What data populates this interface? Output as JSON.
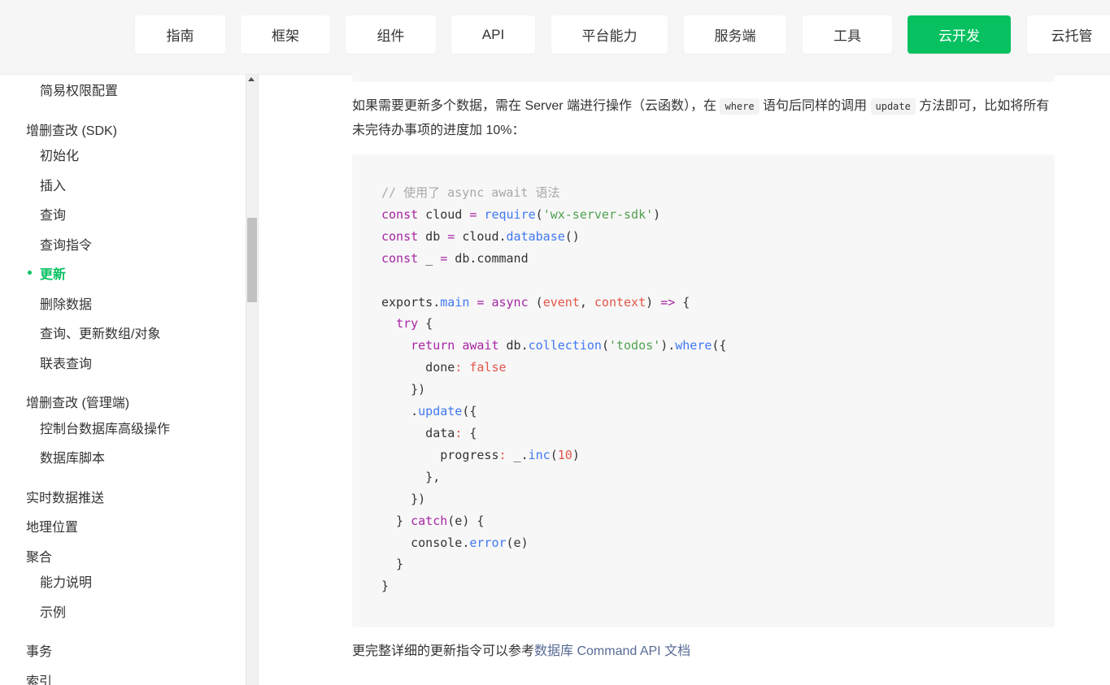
{
  "nav": {
    "items": [
      {
        "label": "指南"
      },
      {
        "label": "框架"
      },
      {
        "label": "组件"
      },
      {
        "label": "API"
      },
      {
        "label": "平台能力"
      },
      {
        "label": "服务端"
      },
      {
        "label": "工具"
      },
      {
        "label": "云开发",
        "active": true
      },
      {
        "label": "云托管"
      }
    ]
  },
  "sidebar": {
    "items": [
      {
        "label": "简易权限配置",
        "level": "sub"
      },
      {
        "label": "增删查改 (SDK)",
        "level": "group"
      },
      {
        "label": "初始化",
        "level": "sub"
      },
      {
        "label": "插入",
        "level": "sub"
      },
      {
        "label": "查询",
        "level": "sub"
      },
      {
        "label": "查询指令",
        "level": "sub"
      },
      {
        "label": "更新",
        "level": "sub",
        "active": true
      },
      {
        "label": "删除数据",
        "level": "sub"
      },
      {
        "label": "查询、更新数组/对象",
        "level": "sub"
      },
      {
        "label": "联表查询",
        "level": "sub"
      },
      {
        "label": "增删查改 (管理端)",
        "level": "group"
      },
      {
        "label": "控制台数据库高级操作",
        "level": "sub"
      },
      {
        "label": "数据库脚本",
        "level": "sub"
      },
      {
        "label": "实时数据推送",
        "level": "group"
      },
      {
        "label": "地理位置",
        "level": "group"
      },
      {
        "label": "聚合",
        "level": "group"
      },
      {
        "label": "能力说明",
        "level": "sub"
      },
      {
        "label": "示例",
        "level": "sub"
      },
      {
        "label": "事务",
        "level": "group"
      },
      {
        "label": "索引",
        "level": "group"
      }
    ]
  },
  "content": {
    "para_part1": "如果需要更新多个数据，需在 Server 端进行操作（云函数），在 ",
    "code_where": "where",
    "para_part2": " 语句后同样的调用 ",
    "code_update": "update",
    "para_part3": " 方法即可，比如将所有未完待办事项的进度加 10%：",
    "code_lines": [
      "// 使用了 async await 语法",
      "const cloud = require('wx-server-sdk')",
      "const db = cloud.database()",
      "const _ = db.command",
      "",
      "exports.main = async (event, context) => {",
      "  try {",
      "    return await db.collection('todos').where({",
      "      done: false",
      "    })",
      "    .update({",
      "      data: {",
      "        progress: _.inc(10)",
      "      },",
      "    })",
      "  } catch(e) {",
      "    console.error(e)",
      "  }",
      "}"
    ],
    "footer_text": "更完整详细的更新指令可以参考",
    "footer_link": "数据库 Command API 文档"
  },
  "colors": {
    "brand": "#07c160",
    "link": "#576b95",
    "keyword": "#a626a4",
    "string": "#50a14f",
    "function": "#4078f2",
    "literal": "#e45649",
    "comment": "#a8a8a8"
  }
}
